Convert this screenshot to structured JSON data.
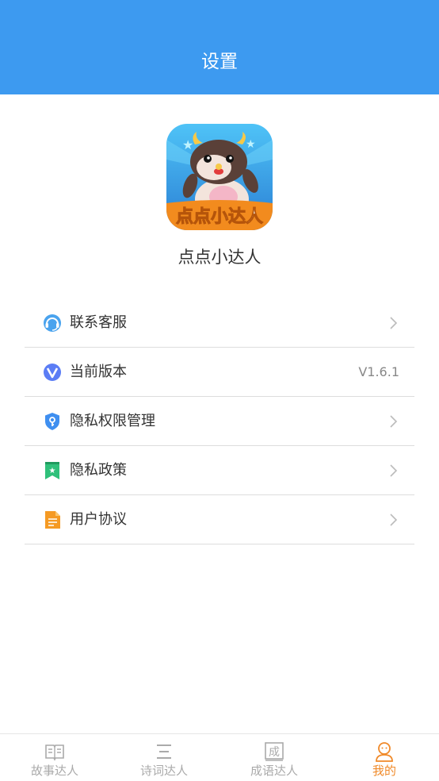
{
  "header": {
    "title": "设置"
  },
  "app": {
    "name": "点点小达人",
    "logo_text": "点点小达人"
  },
  "menu": {
    "items": [
      {
        "label": "联系客服",
        "icon": "headset-icon"
      },
      {
        "label": "当前版本",
        "icon": "version-icon",
        "value": "V1.6.1"
      },
      {
        "label": "隐私权限管理",
        "icon": "shield-key-icon"
      },
      {
        "label": "隐私政策",
        "icon": "bookmark-star-icon"
      },
      {
        "label": "用户协议",
        "icon": "document-icon"
      }
    ]
  },
  "tabbar": {
    "tabs": [
      {
        "label": "故事达人",
        "icon": "book-icon"
      },
      {
        "label": "诗词达人",
        "icon": "poem-icon"
      },
      {
        "label": "成语达人",
        "icon": "idiom-icon",
        "icon_char": "成"
      },
      {
        "label": "我的",
        "icon": "profile-icon",
        "active": true
      }
    ]
  },
  "colors": {
    "header_bg": "#3d9af0",
    "tab_active": "#f08a2a",
    "tab_inactive": "#aaaaaa"
  }
}
